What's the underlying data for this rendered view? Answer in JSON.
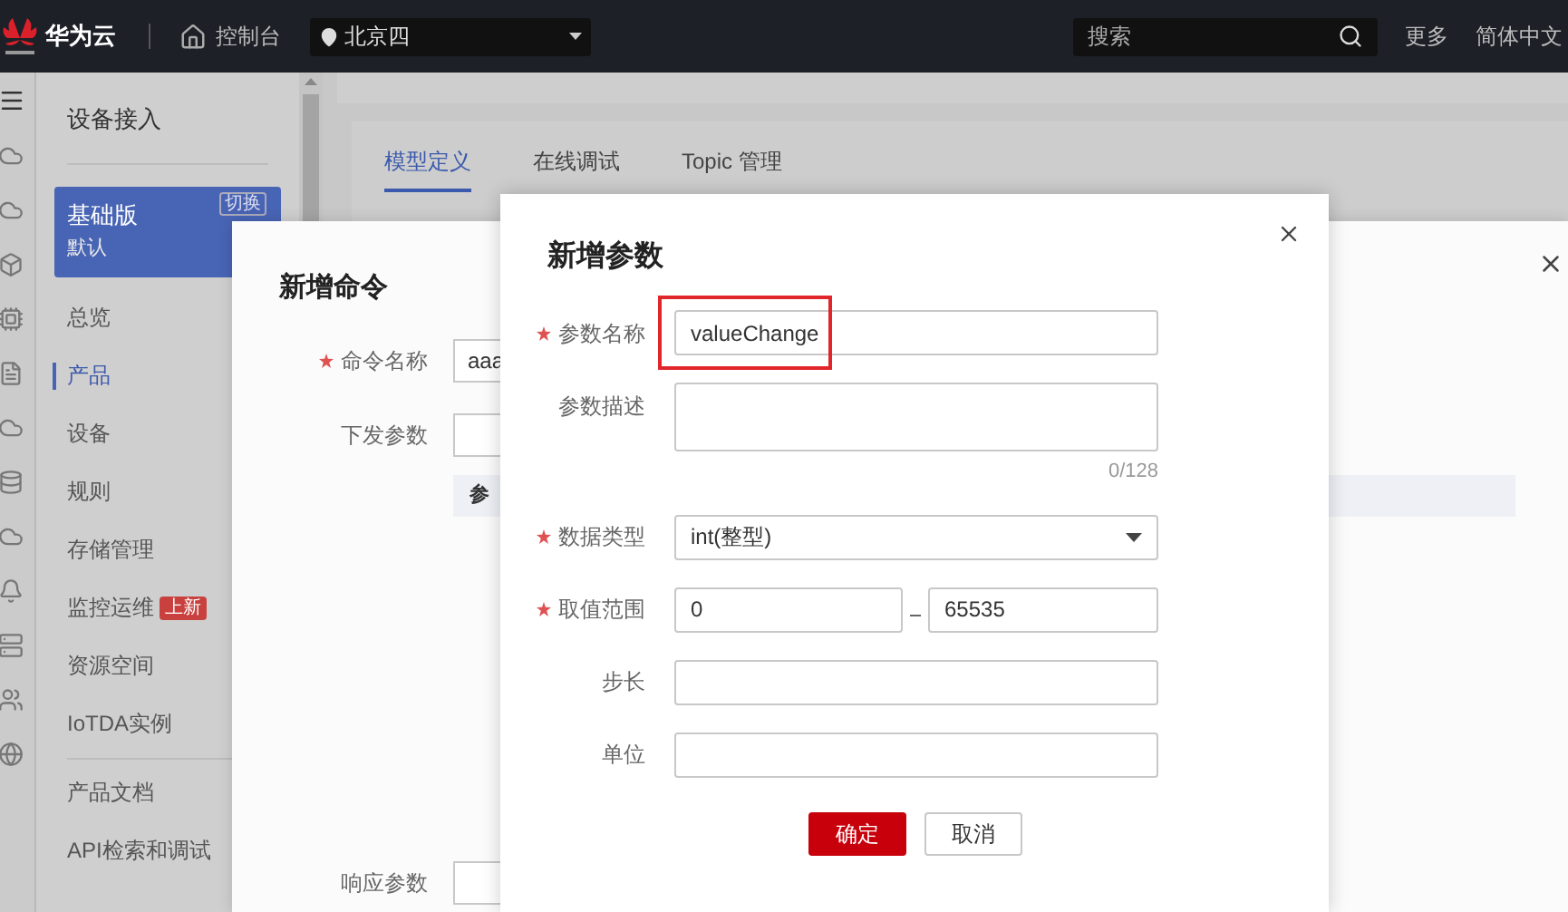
{
  "top_bar": {
    "brand": "华为云",
    "console": "控制台",
    "region": "北京四",
    "search": {
      "placeholder": "搜索"
    },
    "links": [
      "更多",
      "简体中文"
    ]
  },
  "sidebar": {
    "title": "设备接入",
    "edition": {
      "name": "基础版",
      "sub": "默认",
      "switch": "切换"
    },
    "items": [
      {
        "label": "总览",
        "selected": false
      },
      {
        "label": "产品",
        "selected": true
      },
      {
        "label": "设备",
        "selected": false
      },
      {
        "label": "规则",
        "selected": false
      },
      {
        "label": "存储管理",
        "selected": false
      },
      {
        "label": "监控运维",
        "selected": false,
        "badge": "上新"
      },
      {
        "label": "资源空间",
        "selected": false
      },
      {
        "label": "IoTDA实例",
        "selected": false
      }
    ],
    "docs": [
      "产品文档",
      "API检索和调试"
    ]
  },
  "tabs": [
    {
      "label": "模型定义",
      "selected": true
    },
    {
      "label": "在线调试",
      "selected": false
    },
    {
      "label": "Topic 管理",
      "selected": false
    }
  ],
  "command_dialog": {
    "title": "新增命令",
    "name_field": {
      "label": "命令名称",
      "required": true,
      "value": "aaa"
    },
    "request_label": "下发参数",
    "table_header": "参",
    "response_label": "响应参数"
  },
  "param_dialog": {
    "title": "新增参数",
    "fields": [
      {
        "kind": "text",
        "label": "参数名称",
        "required": true,
        "value": "valueChange",
        "highlighted": true
      },
      {
        "kind": "textarea",
        "label": "参数描述",
        "required": false,
        "counter": "0/128"
      },
      {
        "kind": "select",
        "label": "数据类型",
        "required": true,
        "value": "int(整型)"
      },
      {
        "kind": "range",
        "label": "取值范围",
        "required": true,
        "min": "0",
        "max": "65535"
      },
      {
        "kind": "text",
        "label": "步长",
        "required": false
      },
      {
        "kind": "text",
        "label": "单位",
        "required": false
      }
    ],
    "buttons": [
      {
        "label": "确定",
        "kind": "primary"
      },
      {
        "label": "取消",
        "kind": "secondary"
      }
    ]
  }
}
